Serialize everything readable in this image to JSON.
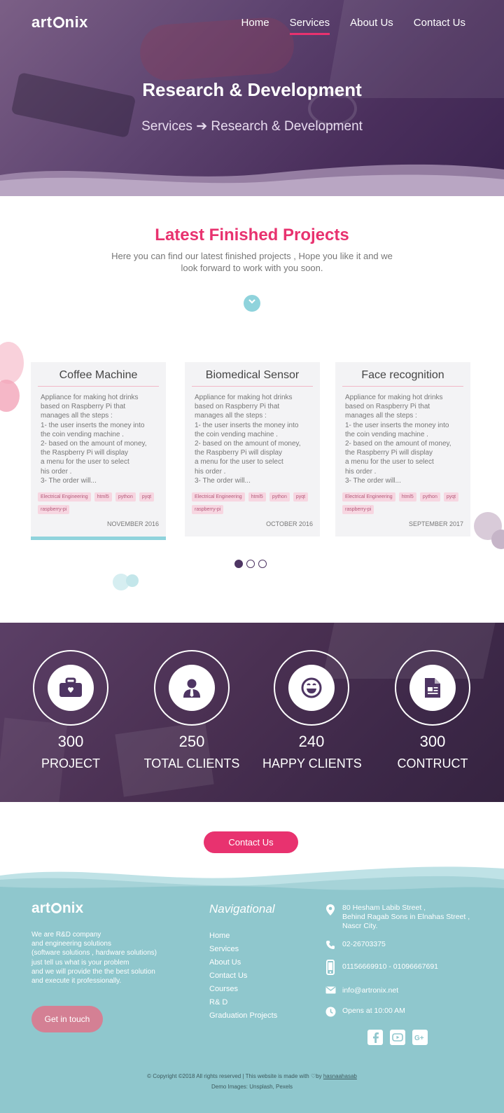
{
  "header": {
    "logo": "artronix",
    "nav": [
      {
        "label": "Home",
        "active": false
      },
      {
        "label": "Services",
        "active": true
      },
      {
        "label": "About Us",
        "active": false
      },
      {
        "label": "Contact Us",
        "active": false
      }
    ],
    "title": "Research & Development",
    "breadcrumb": {
      "parent": "Services",
      "arrow": "➔",
      "current": "Research & Development"
    }
  },
  "projects": {
    "title": "Latest Finished Projects",
    "description": "Here you can find our latest finished projects ,  Hope you like it and we look forward to work with you  soon.",
    "down_icon": "chevron-down-icon",
    "cards": [
      {
        "title": "Coffee Machine",
        "body": "Appliance for making hot drinks\nbased on Raspberry Pi that\nmanages all the steps :\n1- the user inserts the money into\n the coin vending machine .\n2- based on the amount of money,\n the Raspberry Pi will display\n a menu for the user to select\n his order .\n3- The order will...",
        "tags": [
          "Electrical Engineering",
          "html5",
          "python",
          "pyqt",
          "raspberry-pi"
        ],
        "date": "NOVEMBER 2016"
      },
      {
        "title": "Biomedical Sensor",
        "body": "Appliance for making hot drinks\nbased on Raspberry Pi that\nmanages all the steps :\n1- the user inserts the money into\n the coin vending machine .\n2- based on the amount of money,\n the Raspberry Pi will display\n a menu for the user to select\n his order .\n3- The order will...",
        "tags": [
          "Electrical Engineering",
          "html5",
          "python",
          "pyqt",
          "raspberry-pi"
        ],
        "date": "OCTOBER 2016"
      },
      {
        "title": "Face recognition",
        "body": "Appliance for making hot drinks\nbased on Raspberry Pi that\nmanages all the steps :\n1- the user inserts the money into\n the coin vending machine .\n2- based on the amount of money,\n the Raspberry Pi will display\n a menu for the user to select\n his order .\n3- The order will...",
        "tags": [
          "Electrical Engineering",
          "html5",
          "python",
          "pyqt",
          "raspberry-pi"
        ],
        "date": "SEPTEMBER 2017"
      }
    ],
    "pager": {
      "count": 3,
      "active": 1
    }
  },
  "stats": [
    {
      "icon": "briefcase-icon",
      "number": "300",
      "label": "PROJECT"
    },
    {
      "icon": "user-tie-icon",
      "number": "250",
      "label": "TOTAL CLIENTS"
    },
    {
      "icon": "smile-icon",
      "number": "240",
      "label": "HAPPY CLIENTS"
    },
    {
      "icon": "document-icon",
      "number": "300",
      "label": "CONTRUCT"
    }
  ],
  "contact_button": "Contact Us",
  "footer": {
    "logo": "artronix",
    "about": "We are R&D company\nand engineering solutions\n(software solutions , hardware solutions)\njust tell us what is your problem\nand we will provide the the best solution\nand execute it professionally.",
    "get_in_touch": "Get in touch",
    "nav_title": "Navigational",
    "nav": [
      "Home",
      "Services",
      "About Us",
      "Contact Us",
      "Courses",
      "R& D",
      "Graduation Projects"
    ],
    "contact": {
      "address": "80 Hesham Labib Street ,\nBehind Ragab Sons in Elnahas Street ,\n Nascr City.",
      "phone": "02-26703375",
      "mobile": "01156669910 - 01096667691",
      "email": "info@artronix.net",
      "hours": "Opens at 10:00 AM"
    },
    "social": [
      "facebook-icon",
      "youtube-icon",
      "google-plus-icon"
    ],
    "copyright_prefix": "© Copyright ©2018 All rights reserved | This website is made with ",
    "copyright_by": "by ",
    "copyright_author": "hasnaahasab",
    "demo_images": "Demo Images: Unsplash, Pexels"
  },
  "colors": {
    "accent": "#e8326f",
    "purple": "#4e3563",
    "teal": "#8fc7cd",
    "light_teal": "#8fd3dc"
  }
}
